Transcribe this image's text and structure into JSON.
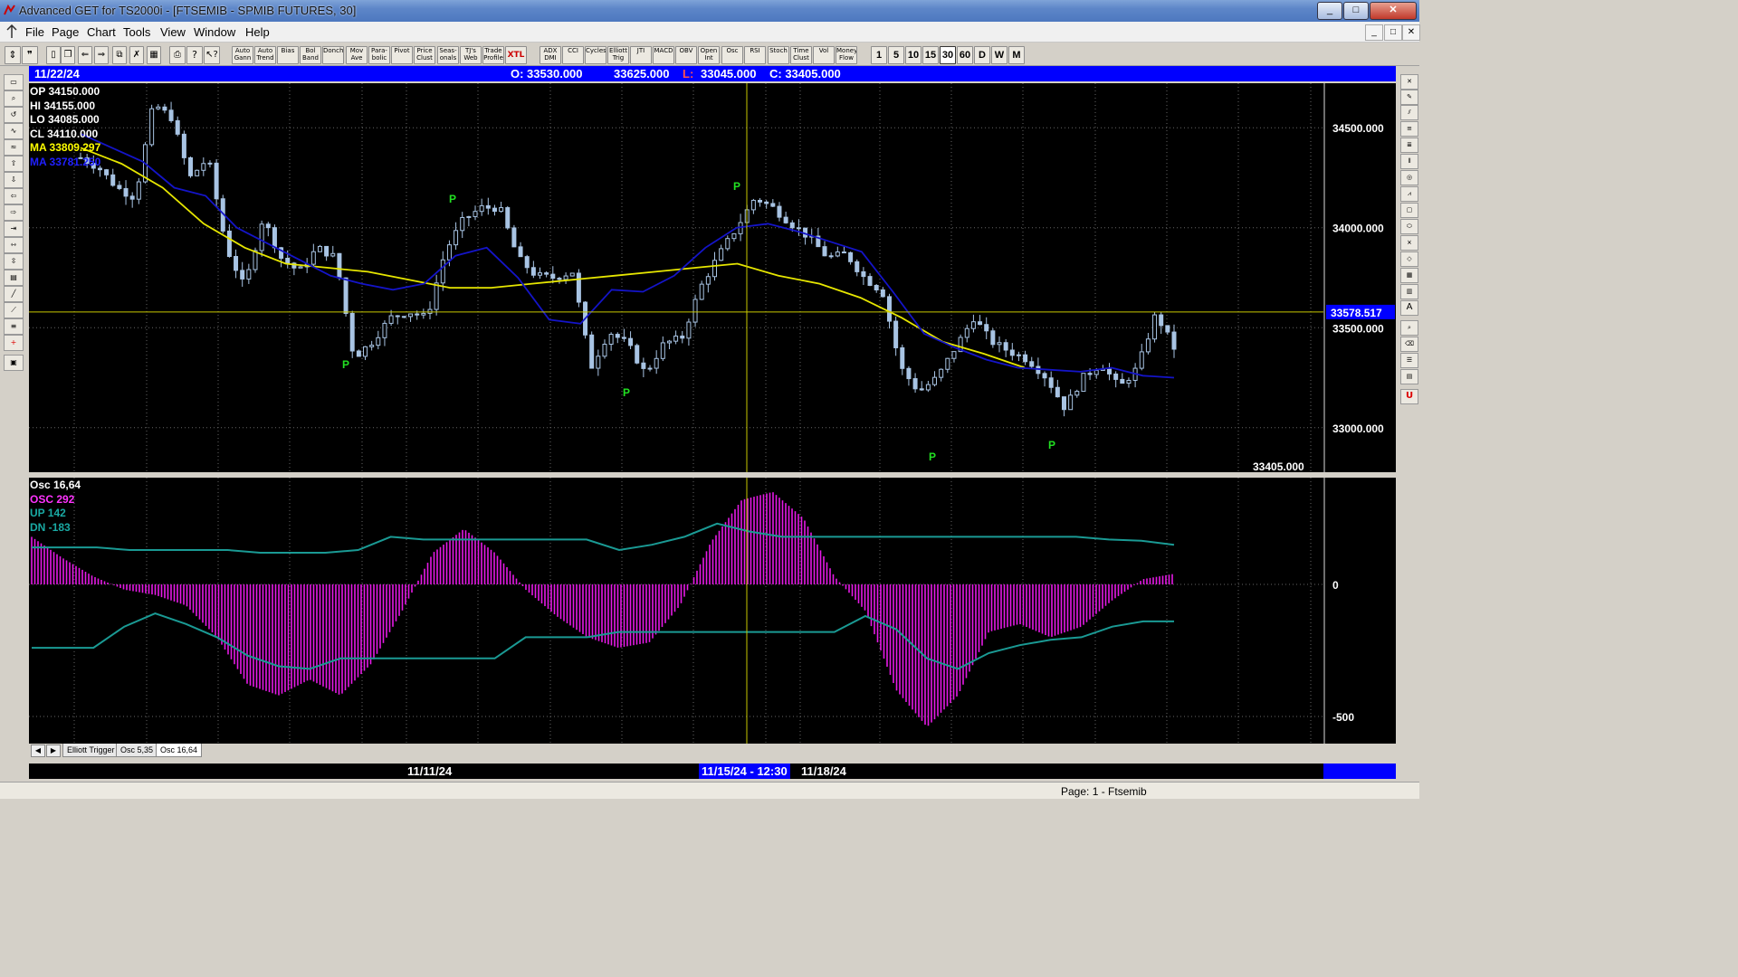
{
  "window": {
    "title": "Advanced GET for TS2000i - [FTSEMIB - SPMIB FUTURES, 30]",
    "min": "_",
    "max": "□",
    "close": "✕"
  },
  "menu": [
    "File",
    "Page",
    "Chart",
    "Tools",
    "View",
    "Window",
    "Help"
  ],
  "toolbar": {
    "studies": [
      "Auto Gann",
      "Auto Trend",
      "Bias",
      "Bol Band",
      "Donch",
      "Mov Ave",
      "Para-bolic",
      "Pivot",
      "Price Clust",
      "Seas-onals",
      "TJ's Web",
      "Trade Profile",
      "XTL",
      "ADX DMI",
      "CCI",
      "Cycles",
      "Elliott Trig",
      "JTI",
      "MACD",
      "OBV",
      "Open Int",
      "Osc",
      "RSI",
      "Stoch",
      "Time Clust",
      "Vol",
      "Money Flow"
    ],
    "intervals": [
      "1",
      "5",
      "10",
      "15",
      "30",
      "60",
      "D",
      "W",
      "M"
    ]
  },
  "databar": {
    "date": "11/22/24",
    "open": "O: 33530.000",
    "high": "33625.000",
    "low_prefix": "L:",
    "low": "33045.000",
    "close": "C: 33405.000"
  },
  "legend": {
    "op": "OP  34150.000",
    "hi": "HI   34155.000",
    "lo": "LO  34085.000",
    "cl": "CL  34110.000",
    "ma1": "MA  33809.297",
    "ma2": "MA  33781.250"
  },
  "price_axis": {
    "ticks": [
      "34500.000",
      "34000.000",
      "33500.000",
      "33000.000"
    ],
    "crosshair_price": "33578.517",
    "last_price": "33405.000"
  },
  "pivots": [
    "P",
    "P",
    "P",
    "P",
    "P",
    "P"
  ],
  "osc_legend": {
    "title": "Osc 16,64",
    "osc": "OSC 292",
    "up": "UP    142",
    "dn": "DN   -183"
  },
  "osc_axis": {
    "ticks": [
      "0",
      "-500"
    ]
  },
  "tabs": [
    "Elliott Trigger",
    "Osc 5,35",
    "Osc 16,64"
  ],
  "timebar": {
    "label1": "11/11/24",
    "current": "11/15/24 - 12:30",
    "label2": "11/18/24"
  },
  "status": "Page: 1 - Ftsemib",
  "colors": {
    "candles": "#a8c4e4",
    "ma_fast": "#1414c8",
    "ma_slow": "#e6e600",
    "osc": "#e619e6",
    "bands": "#1a9a94",
    "pivot": "#22e022",
    "crosshair": "#c8c800"
  },
  "chart_data": [
    {
      "type": "candlestick",
      "y_range": [
        32800,
        34700
      ],
      "y_ticks": [
        34500,
        34000,
        33500,
        33000
      ],
      "close_series": [
        34350,
        34300,
        34200,
        34150,
        34620,
        34550,
        34250,
        34350,
        33900,
        33700,
        34050,
        33850,
        33780,
        33900,
        33850,
        33350,
        33430,
        33550,
        33580,
        33550,
        33880,
        34040,
        34100,
        34100,
        33850,
        33760,
        33750,
        33780,
        33300,
        33480,
        33420,
        33270,
        33420,
        33450,
        33700,
        33860,
        34000,
        34150,
        34100,
        34020,
        33950,
        33850,
        33870,
        33750,
        33680,
        33300,
        33180,
        33250,
        33400,
        33550,
        33430,
        33380,
        33340,
        33250,
        33100,
        33250,
        33320,
        33200,
        33300,
        33570,
        33400
      ],
      "ma_fast_series": [
        34470,
        34400,
        34330,
        34200,
        34160,
        34000,
        33920,
        33840,
        33760,
        33720,
        33690,
        33720,
        33860,
        33900,
        33750,
        33540,
        33520,
        33690,
        33680,
        33760,
        33900,
        34000,
        34020,
        33980,
        33930,
        33880,
        33680,
        33470,
        33400,
        33340,
        33300,
        33290,
        33280,
        33300,
        33260,
        33250
      ],
      "ma_slow_series": [
        34400,
        34320,
        34200,
        34020,
        33900,
        33820,
        33800,
        33780,
        33740,
        33700,
        33700,
        33720,
        33740,
        33760,
        33780,
        33800,
        33820,
        33760,
        33720,
        33650,
        33550,
        33430,
        33370,
        33300
      ],
      "last": 33405,
      "crosshair": 33578.517
    },
    {
      "type": "bar",
      "title": "Osc 16,64",
      "y_ticks": [
        0,
        -500
      ],
      "osc_series": [
        180,
        100,
        30,
        -20,
        -40,
        -80,
        -200,
        -380,
        -420,
        -360,
        -420,
        -300,
        -100,
        120,
        210,
        120,
        -20,
        -120,
        -200,
        -240,
        -220,
        -80,
        160,
        320,
        350,
        250,
        30,
        -100,
        -400,
        -540,
        -420,
        -180,
        -150,
        -200,
        -160,
        -60,
        20,
        40
      ],
      "up_series": [
        140,
        140,
        140,
        130,
        130,
        130,
        130,
        120,
        120,
        120,
        130,
        180,
        170,
        170,
        170,
        170,
        170,
        170,
        130,
        150,
        180,
        230,
        200,
        180,
        180,
        180,
        180,
        180,
        180,
        180,
        180,
        180,
        180,
        170,
        165,
        150
      ],
      "dn_series": [
        -240,
        -240,
        -240,
        -160,
        -110,
        -150,
        -200,
        -270,
        -310,
        -320,
        -280,
        -280,
        -280,
        -280,
        -280,
        -280,
        -200,
        -200,
        -200,
        -180,
        -180,
        -180,
        -180,
        -180,
        -180,
        -180,
        -180,
        -120,
        -170,
        -280,
        -320,
        -260,
        -230,
        -210,
        -200,
        -160,
        -140,
        -140
      ],
      "osc_label": 292,
      "up_label": 142,
      "dn_label": -183
    }
  ]
}
